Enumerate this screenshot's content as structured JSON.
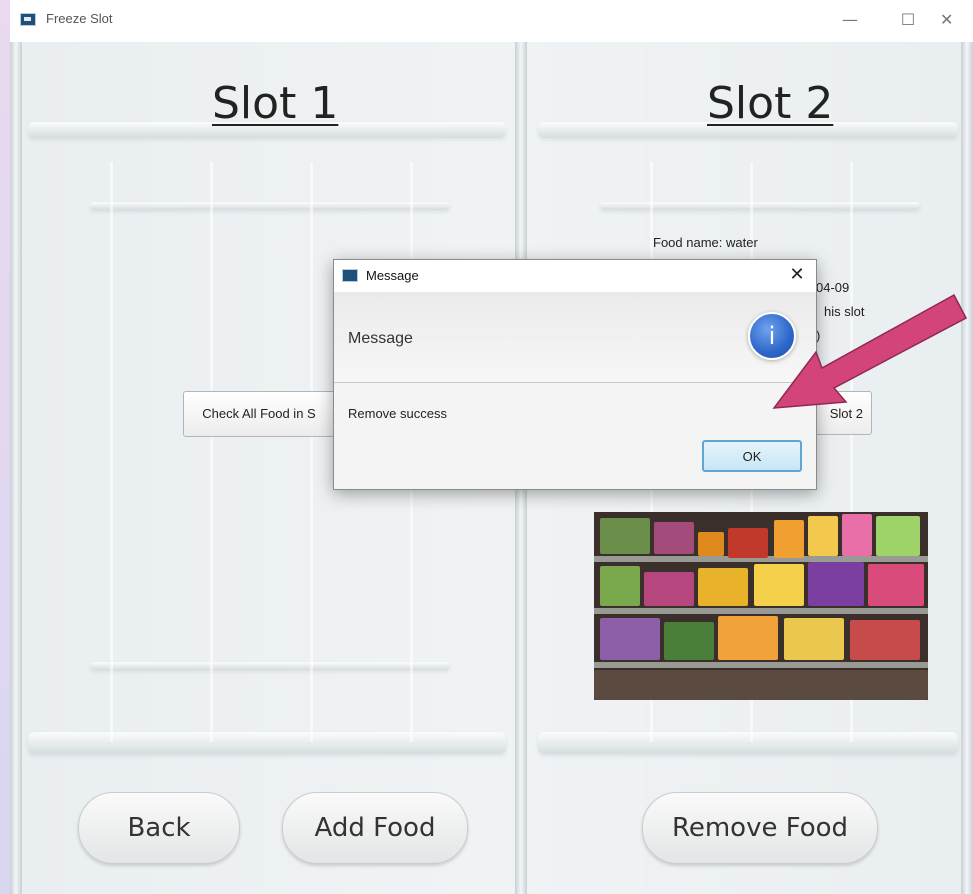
{
  "window": {
    "title": "Freeze Slot"
  },
  "slot1": {
    "title": "Slot 1",
    "check_button": "Check All Food in S"
  },
  "slot2": {
    "title": "Slot 2",
    "food_name": "Food name: water",
    "fragment_date": "04-09",
    "fragment_slot": "his slot",
    "fragment_other": ")",
    "check_button": "Slot 2"
  },
  "buttons": {
    "back": "Back",
    "add_food": "Add Food",
    "remove_food": "Remove Food"
  },
  "dialog": {
    "title": "Message",
    "header": "Message",
    "content": "Remove success",
    "ok": "OK",
    "icon_glyph": "i"
  },
  "colors": {
    "arrow": "#d2447a",
    "info_icon": "#2e66c9",
    "ok_border": "#5fa5d6"
  }
}
